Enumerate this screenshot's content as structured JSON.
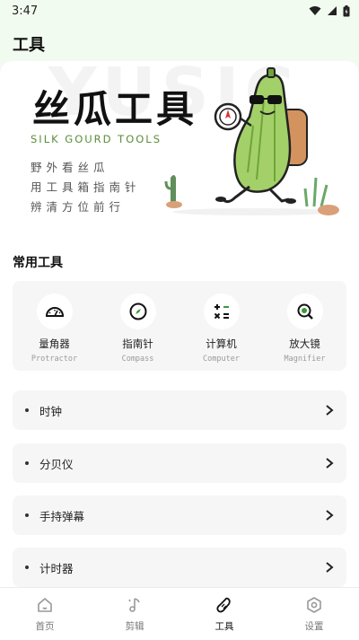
{
  "status_bar": {
    "time": "3:47"
  },
  "app_bar": {
    "title": "工具"
  },
  "banner": {
    "background_text": "YUSIC",
    "title": "丝瓜工具",
    "subtitle": "SILK GOURD TOOLS",
    "lines": [
      "野外看丝瓜",
      "用工具箱指南针",
      "辨清方位前行"
    ]
  },
  "common_tools": {
    "section_title": "常用工具",
    "items": [
      {
        "name": "量角器",
        "en": "Protractor",
        "icon": "protractor-icon"
      },
      {
        "name": "指南针",
        "en": "Compass",
        "icon": "compass-icon"
      },
      {
        "name": "计算机",
        "en": "Computer",
        "icon": "calculator-icon"
      },
      {
        "name": "放大镜",
        "en": "Magnifier",
        "icon": "magnifier-icon"
      }
    ]
  },
  "tool_list": [
    {
      "label": "时钟"
    },
    {
      "label": "分贝仪"
    },
    {
      "label": "手持弹幕"
    },
    {
      "label": "计时器"
    }
  ],
  "bottom_nav": {
    "items": [
      {
        "label": "首页",
        "icon": "home-icon",
        "active": false
      },
      {
        "label": "剪辑",
        "icon": "music-note-icon",
        "active": false
      },
      {
        "label": "工具",
        "icon": "gourd-icon",
        "active": true
      },
      {
        "label": "设置",
        "icon": "settings-icon",
        "active": false
      }
    ]
  },
  "colors": {
    "accent_green": "#5c8c3a",
    "app_background": "#f2fbef"
  }
}
